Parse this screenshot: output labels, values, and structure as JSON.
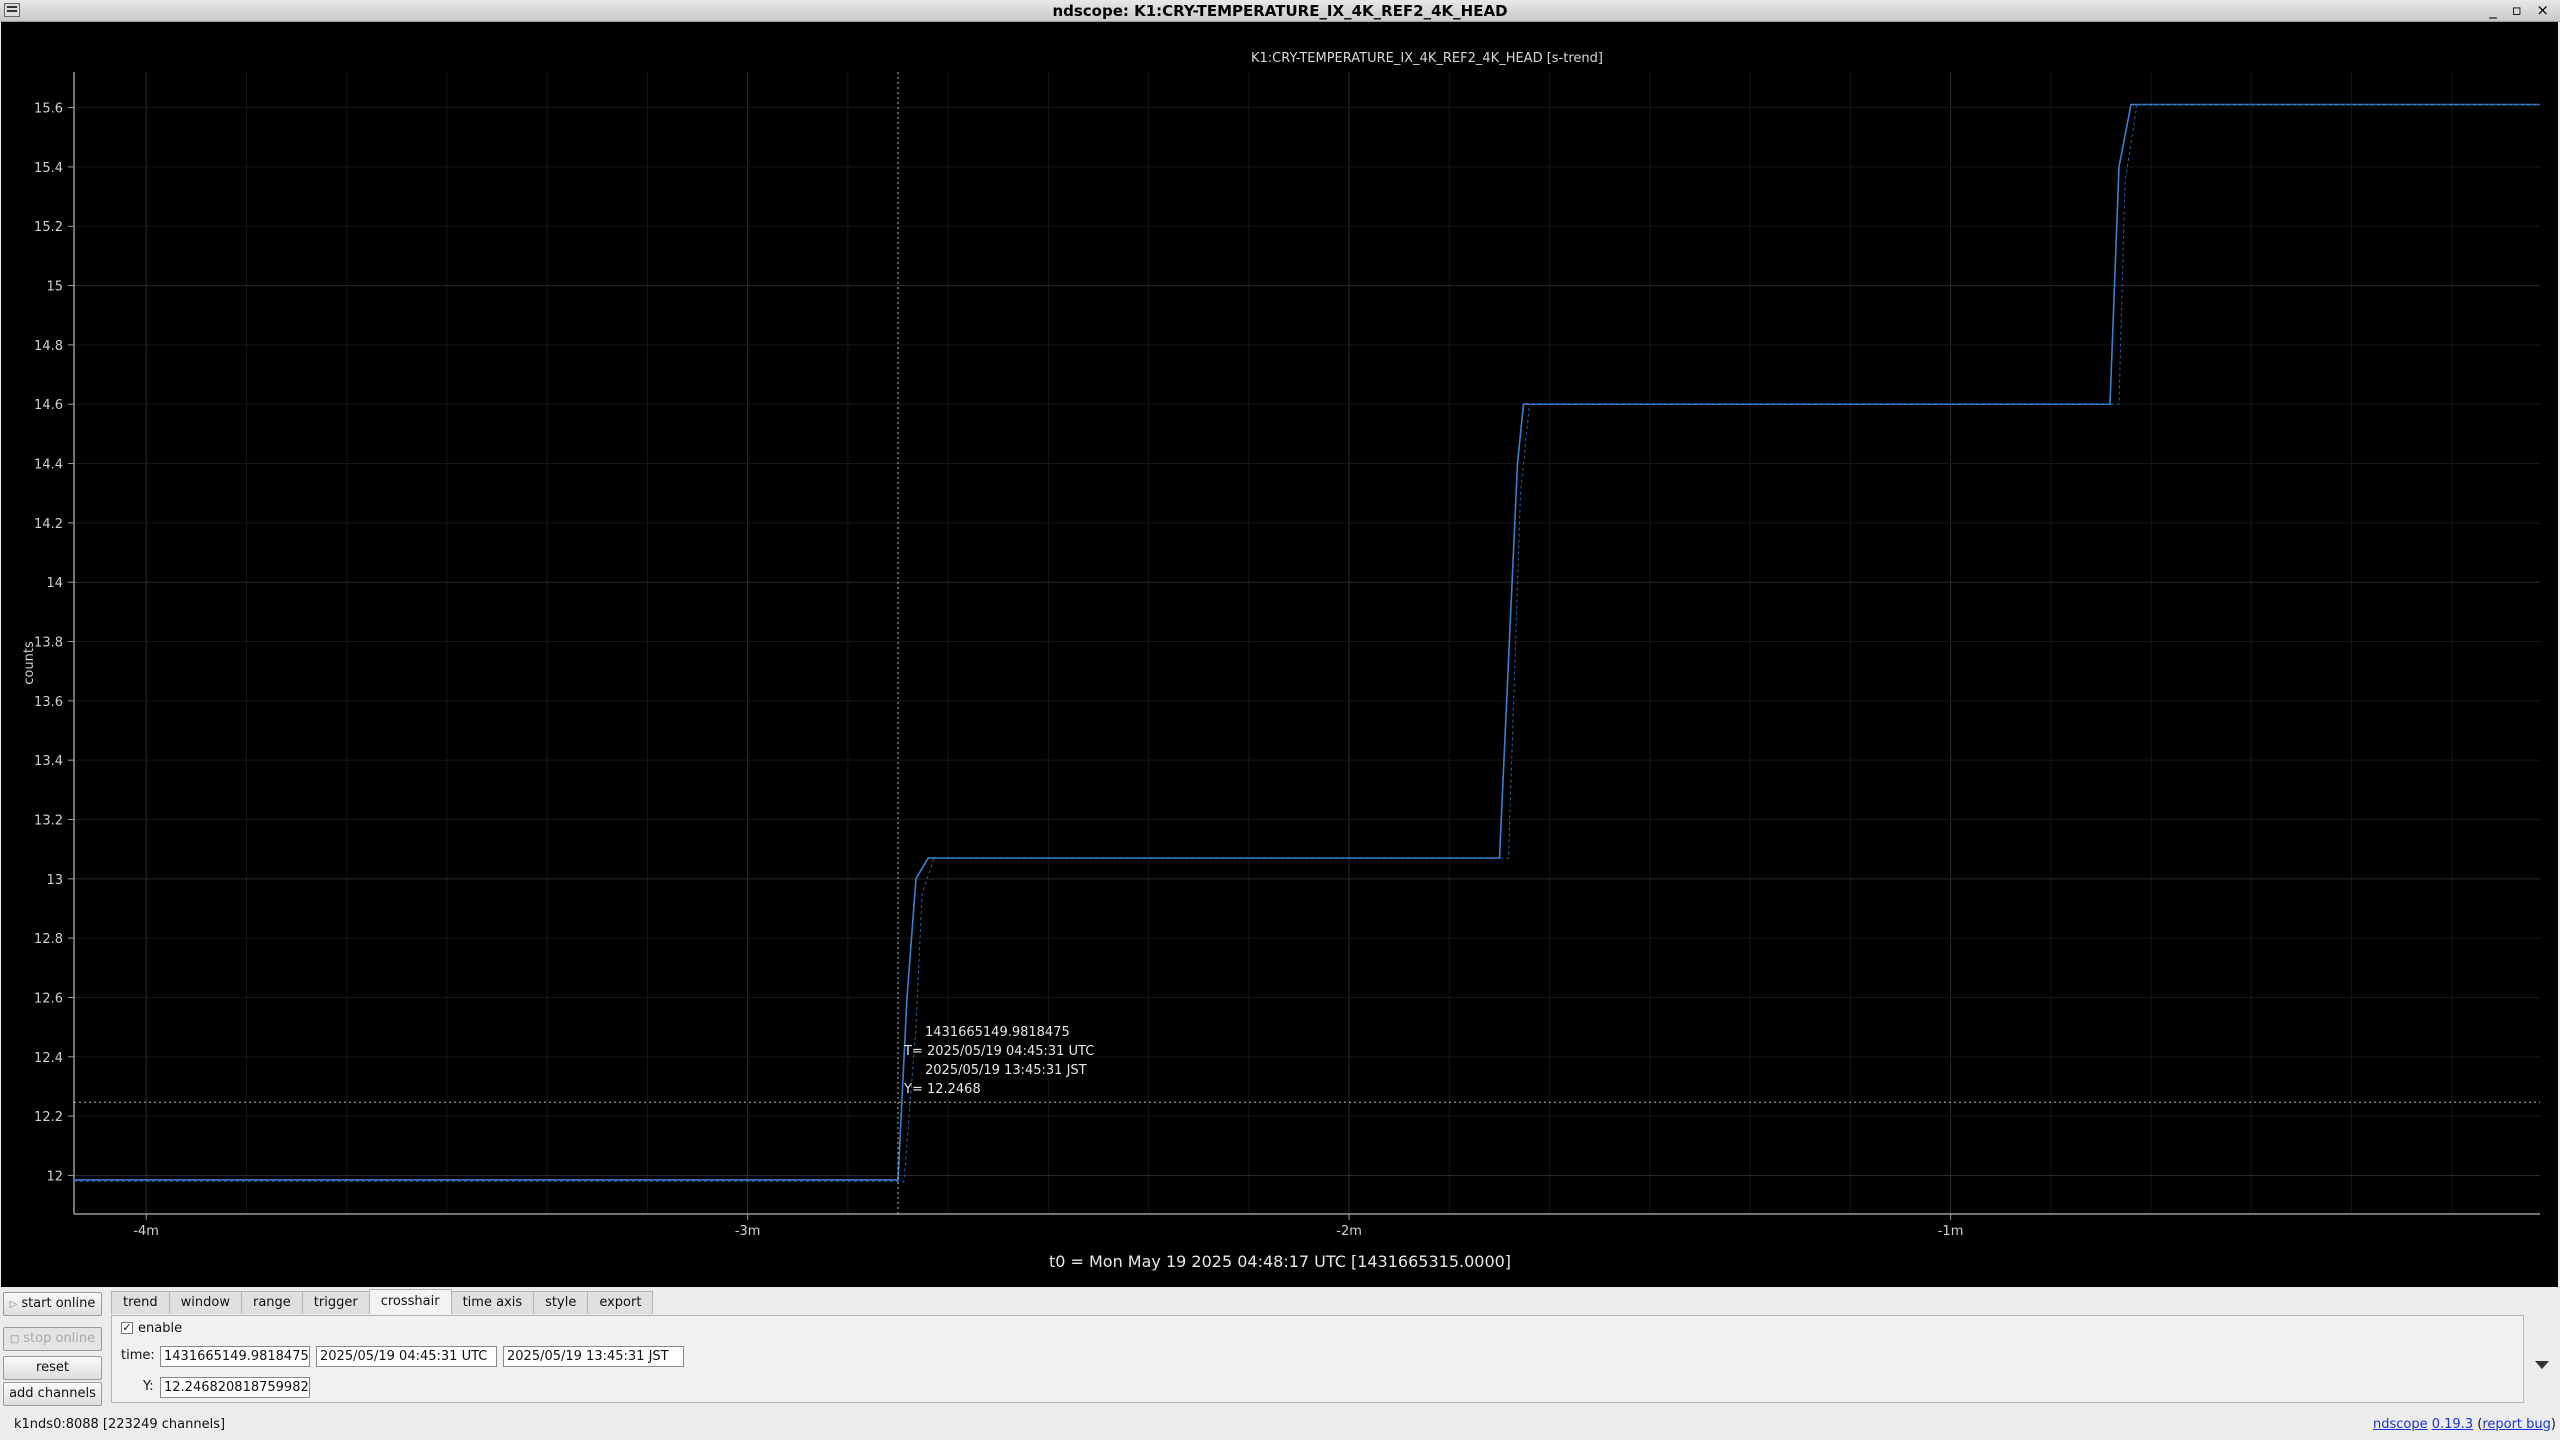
{
  "window": {
    "title": "ndscope: K1:CRY-TEMPERATURE_IX_4K_REF2_4K_HEAD",
    "controls": "_ ▫ ×"
  },
  "chart_data": {
    "type": "line",
    "title": "K1:CRY-TEMPERATURE_IX_4K_REF2_4K_HEAD [s-trend]",
    "xlabel": "",
    "ylabel": "counts",
    "xlim": [
      -4.12,
      -0.02
    ],
    "ylim": [
      11.87,
      15.72
    ],
    "grid": true,
    "x_ticks": [
      {
        "value": -4,
        "label": "-4m"
      },
      {
        "value": -3,
        "label": "-3m"
      },
      {
        "value": -2,
        "label": "-2m"
      },
      {
        "value": -1,
        "label": "-1m"
      }
    ],
    "y_ticks": [
      {
        "value": 12,
        "label": "12"
      },
      {
        "value": 12.2,
        "label": "12.2"
      },
      {
        "value": 12.4,
        "label": "12.4"
      },
      {
        "value": 12.6,
        "label": "12.6"
      },
      {
        "value": 12.8,
        "label": "12.8"
      },
      {
        "value": 13,
        "label": "13"
      },
      {
        "value": 13.2,
        "label": "13.2"
      },
      {
        "value": 13.4,
        "label": "13.4"
      },
      {
        "value": 13.6,
        "label": "13.6"
      },
      {
        "value": 13.8,
        "label": "13.8"
      },
      {
        "value": 14,
        "label": "14"
      },
      {
        "value": 14.2,
        "label": "14.2"
      },
      {
        "value": 14.4,
        "label": "14.4"
      },
      {
        "value": 14.6,
        "label": "14.6"
      },
      {
        "value": 14.8,
        "label": "14.8"
      },
      {
        "value": 15,
        "label": "15"
      },
      {
        "value": 15.2,
        "label": "15.2"
      },
      {
        "value": 15.4,
        "label": "15.4"
      },
      {
        "value": 15.6,
        "label": "15.6"
      }
    ],
    "series": [
      {
        "color": "#3a7fd0",
        "x": [
          -4.12,
          -2.75,
          -2.735,
          -2.72,
          -2.7,
          -1.75,
          -1.72,
          -1.71,
          -0.735,
          -0.72,
          -0.7,
          -0.02
        ],
        "y": [
          11.985,
          11.985,
          12.6,
          13.0,
          13.07,
          13.07,
          14.4,
          14.6,
          14.6,
          15.4,
          15.61,
          15.61
        ]
      },
      {
        "color": "#2a5f9a",
        "dashed": true,
        "x": [
          -4.12,
          -2.74,
          -2.72,
          -2.71,
          -2.69,
          -1.735,
          -1.715,
          -1.7,
          -0.72,
          -0.71,
          -0.69,
          -0.02
        ],
        "y": [
          11.98,
          11.98,
          12.5,
          12.95,
          13.07,
          13.07,
          14.3,
          14.6,
          14.6,
          15.35,
          15.61,
          15.61
        ]
      }
    ],
    "crosshair": {
      "x": -2.75,
      "y": 12.2468,
      "gps": "1431665149.9818475",
      "utc": "T= 2025/05/19 04:45:31 UTC",
      "jst": "2025/05/19 13:45:31 JST",
      "yval": "Y= 12.2468"
    }
  },
  "t0_label": "t0 = Mon May 19 2025 04:48:17 UTC [1431665315.0000]",
  "buttons": {
    "start_online": "start online",
    "stop_online": "stop online",
    "reset": "reset",
    "add_channels": "add channels"
  },
  "tabs": [
    "trend",
    "window",
    "range",
    "trigger",
    "crosshair",
    "time axis",
    "style",
    "export"
  ],
  "active_tab": "crosshair",
  "crosshair_panel": {
    "enable_checked": true,
    "enable_label": "enable",
    "time_label": "time:",
    "time_gps": "1431665149.9818475",
    "time_utc": "2025/05/19 04:45:31 UTC",
    "time_jst": "2025/05/19 13:45:31 JST",
    "y_label": "Y:",
    "y_value": "12.246820818759982"
  },
  "status": {
    "server": "k1nds0:8088  [223249 channels]",
    "app_name": "ndscope",
    "version": "0.19.3",
    "report_bug": "report bug",
    "paren_open": "(",
    "paren_close": ")"
  }
}
